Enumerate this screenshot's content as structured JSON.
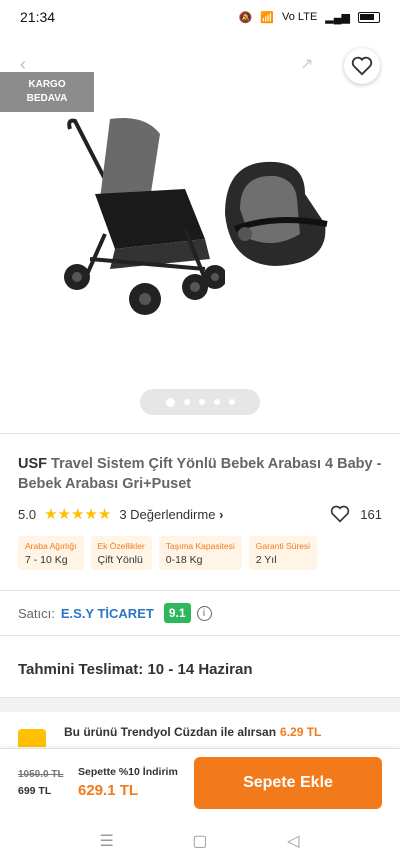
{
  "status": {
    "time": "21:34",
    "network": "Vo LTE",
    "battery": ""
  },
  "hero": {
    "badge_line1": "KARGO",
    "badge_line2": "BEDAVA",
    "image_count": 5,
    "active_image": 1
  },
  "product": {
    "brand": "USF",
    "title": "Travel Sistem Çift Yönlü Bebek Arabası 4 Baby - Bebek Arabası Gri+Puset",
    "rating": "5.0",
    "stars": 5,
    "reviews": "3 Değerlendirme",
    "favorites": "161",
    "attributes": [
      {
        "key": "Araba Ağırlığı",
        "value": "7 - 10 Kg"
      },
      {
        "key": "Ek Özellikler",
        "value": "Çift Yönlü"
      },
      {
        "key": "Taşıma Kapasitesi",
        "value": "0-18 Kg"
      },
      {
        "key": "Garanti Süresi",
        "value": "2 Yıl"
      }
    ]
  },
  "seller": {
    "label": "Satıcı:",
    "name": "E.S.Y TİCARET",
    "score": "9.1",
    "info_icon": "i"
  },
  "delivery": {
    "label": "Tahmini Teslimat:",
    "value": "10 - 14 Haziran"
  },
  "wallet": {
    "text": "Bu ürünü Trendyol Cüzdan ile alırsan",
    "amount": "6.29 TL"
  },
  "buybar": {
    "old_price": "1050.0 TL",
    "current_price": "699 TL",
    "promo_text": "Sepette %10 İndirim",
    "promo_price": "629.1 TL",
    "add_label": "Sepete Ekle"
  },
  "colors": {
    "accent": "#f27a1a",
    "star": "#ffc000",
    "score": "#2eb85c",
    "seller": "#2b76c5"
  }
}
